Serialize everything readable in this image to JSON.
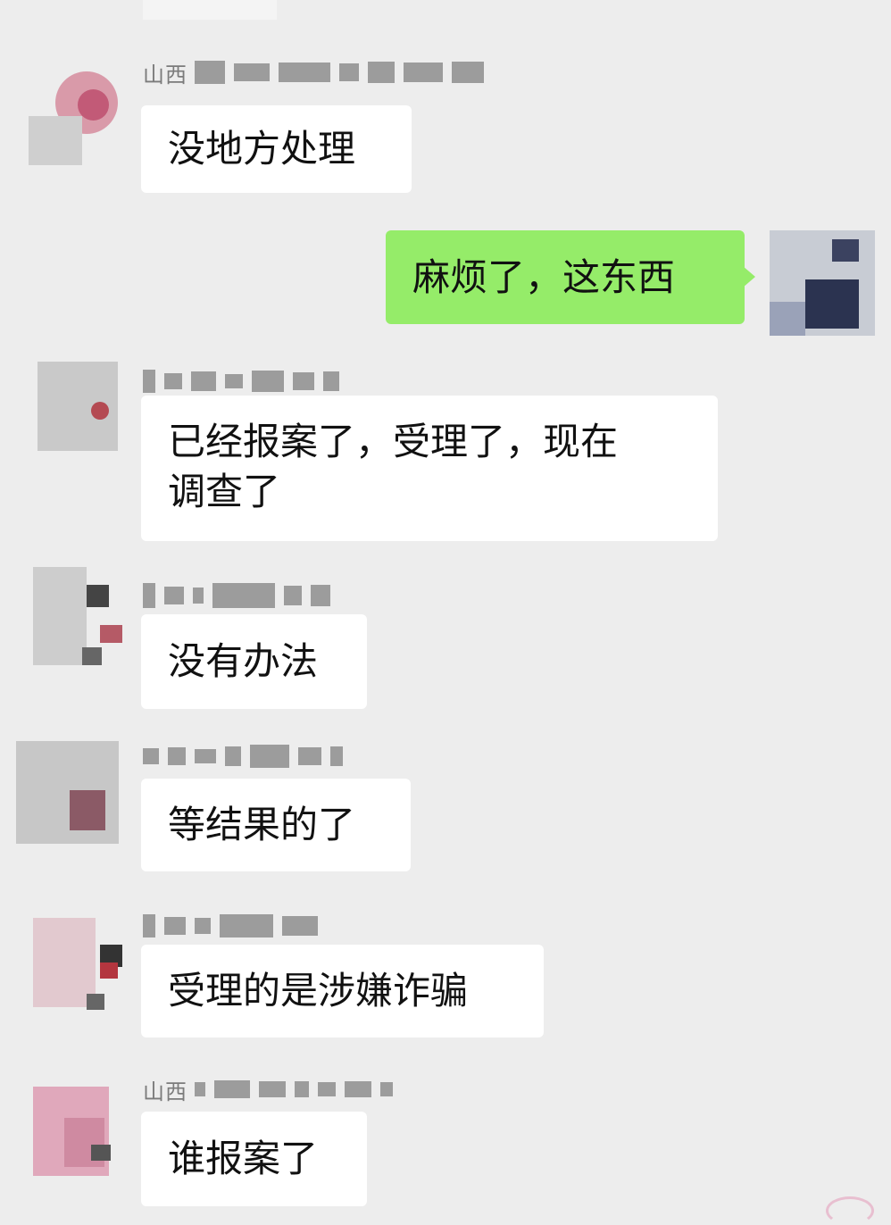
{
  "chat": {
    "messages": [
      {
        "direction": "in",
        "sender_prefix": "山西",
        "text": "没地方处理"
      },
      {
        "direction": "out",
        "text": "麻烦了，这东西"
      },
      {
        "direction": "in",
        "sender_prefix": "",
        "text": "已经报案了，受理了，现在\n调查了"
      },
      {
        "direction": "in",
        "sender_prefix": "",
        "text": "没有办法"
      },
      {
        "direction": "in",
        "sender_prefix": "",
        "text": "等结果的了"
      },
      {
        "direction": "in",
        "sender_prefix": "",
        "text": "受理的是涉嫌诈骗"
      },
      {
        "direction": "in",
        "sender_prefix": "山西",
        "text": "谁报案了"
      }
    ]
  },
  "colors": {
    "background": "#ededed",
    "incoming_bubble": "#ffffff",
    "outgoing_bubble": "#95ec69"
  }
}
